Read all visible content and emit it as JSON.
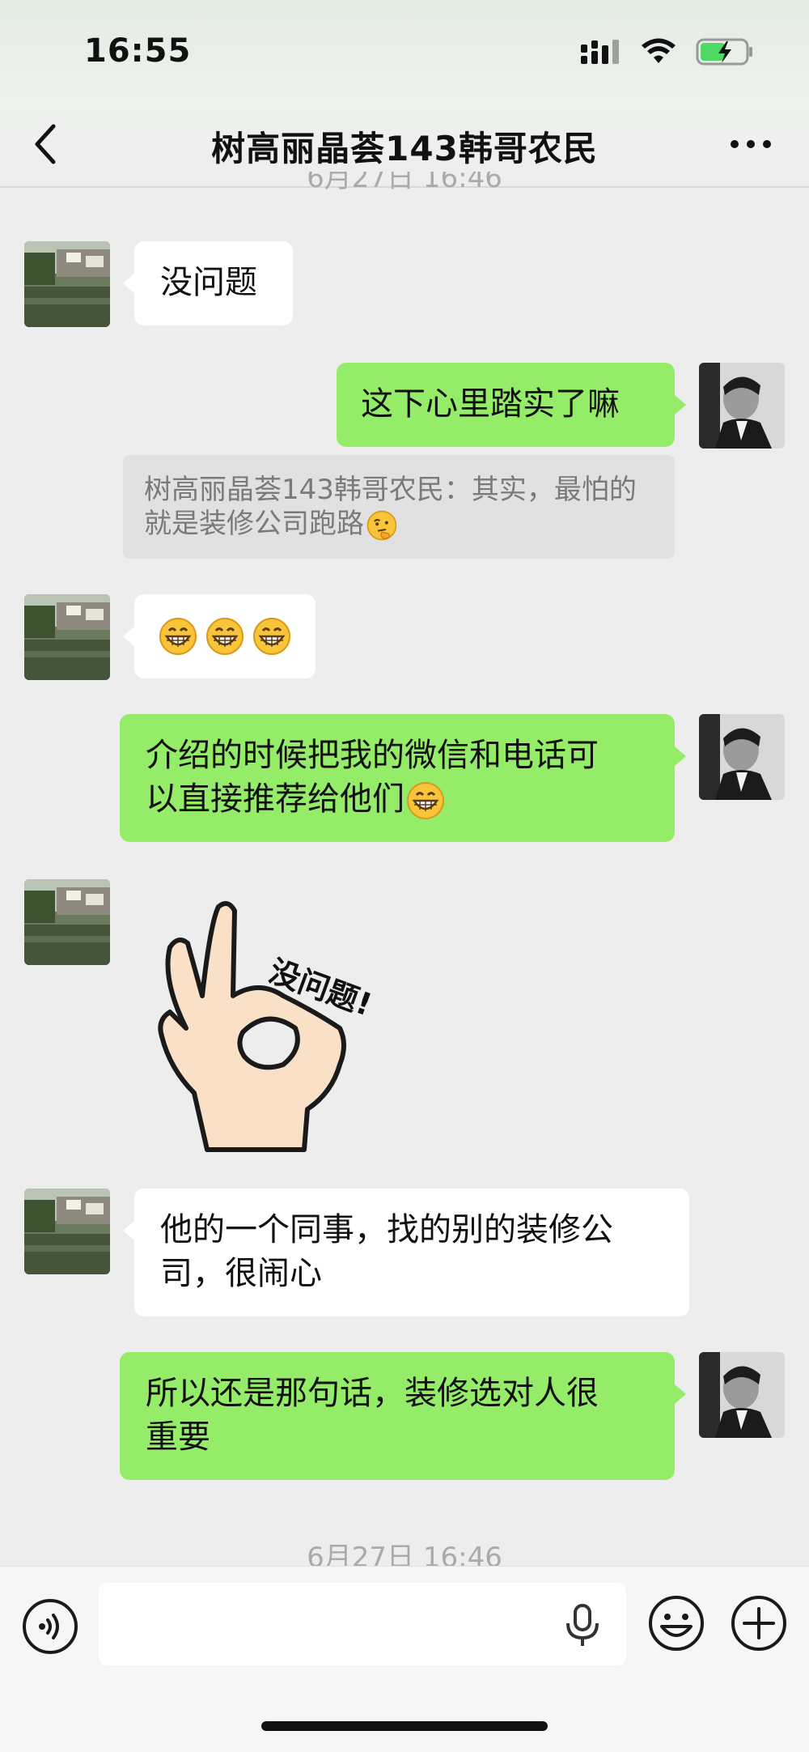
{
  "status_bar": {
    "time": "16:55",
    "icons": [
      "signal-icon",
      "wifi-icon",
      "battery-charging-icon"
    ]
  },
  "nav": {
    "title": "树高丽晶荟143韩哥农民",
    "back_icon": "chevron-left-icon",
    "more_icon": "more-dots-icon"
  },
  "timestamp_top_partial": "6月27日 16:46",
  "messages": [
    {
      "side": "left",
      "type": "text",
      "text": "没问题"
    },
    {
      "side": "right",
      "type": "text",
      "text": "这下心里踏实了嘛"
    },
    {
      "type": "quote",
      "text": "树高丽晶荟143韩哥农民：其实，最怕的就是装修公司跑路",
      "emoji": "thinking-face"
    },
    {
      "side": "left",
      "type": "emoji",
      "emojis": [
        "grinning-face",
        "grinning-face",
        "grinning-face"
      ]
    },
    {
      "side": "right",
      "type": "text",
      "line1": "介绍的时候把我的微信和电话可",
      "line2": "以直接推荐给他们",
      "emoji": "grinning-face"
    },
    {
      "side": "left",
      "type": "sticker",
      "sticker_text": "没问题!"
    },
    {
      "side": "left",
      "type": "text",
      "line1": "他的一个同事，找的别的装修公",
      "line2": "司，很闹心"
    },
    {
      "side": "right",
      "type": "text",
      "line1": "所以还是那句话，装修选对人很",
      "line2": "重要"
    }
  ],
  "timestamp_bottom": "6月27日 16:46",
  "input_bar": {
    "placeholder": "",
    "voice_icon": "voice-icon",
    "mic_icon": "microphone-icon",
    "emoji_icon": "emoji-icon",
    "plus_icon": "plus-icon"
  },
  "colors": {
    "green_bubble": "#95ec69",
    "white_bubble": "#ffffff",
    "background": "#ededed"
  }
}
